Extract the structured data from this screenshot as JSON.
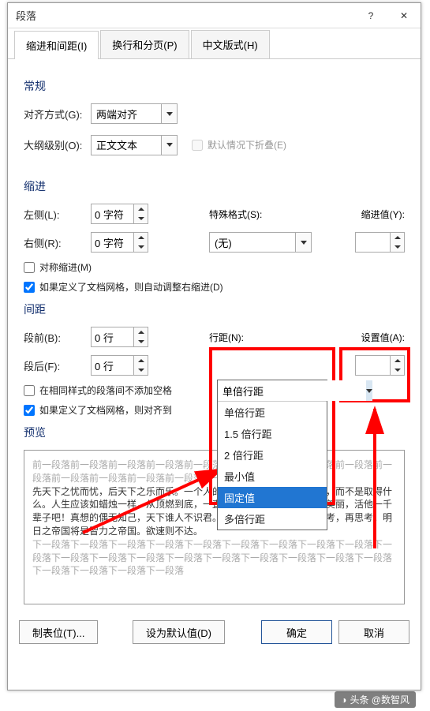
{
  "title": "段落",
  "tabs": [
    "缩进和间距(I)",
    "换行和分页(P)",
    "中文版式(H)"
  ],
  "general": {
    "header": "常规",
    "align_label": "对齐方式(G):",
    "align_value": "两端对齐",
    "outline_label": "大纲级别(O):",
    "outline_value": "正文文本",
    "collapse_label": "默认情况下折叠(E)"
  },
  "indent": {
    "header": "缩进",
    "left_label": "左侧(L):",
    "left_value": "0 字符",
    "right_label": "右侧(R):",
    "right_value": "0 字符",
    "special_label": "特殊格式(S):",
    "special_value": "(无)",
    "by_label": "缩进值(Y):",
    "by_value": "",
    "mirror_label": "对称缩进(M)",
    "autogrid_label": "如果定义了文档网格，则自动调整右缩进(D)"
  },
  "spacing": {
    "header": "间距",
    "before_label": "段前(B):",
    "before_value": "0 行",
    "after_label": "段后(F):",
    "after_value": "0 行",
    "linespacing_label": "行距(N):",
    "linespacing_value": "单倍行距",
    "at_label": "设置值(A):",
    "at_value": "",
    "options": [
      "单倍行距",
      "1.5 倍行距",
      "2 倍行距",
      "最小值",
      "固定值",
      "多倍行距"
    ],
    "nospace_label": "在相同样式的段落间不添加空格",
    "snapgrid_label": "如果定义了文档网格，则对齐到"
  },
  "preview": {
    "header": "预览",
    "gray1": "前一段落前一段落前一段落前一段落前一段落前一段落前一段落前一段落前一段落前一段落前一段落前一段落前一段落前一段落前一段落",
    "dark": "先天下之忧而忧，后天下之乐而乐。一个人的价值，应当看他贡献什么，而不是取得什么。人生应该如蜡烛一样，从顶燃到底，一直都是光明的。生活是这样美丽，活他一千辈子吧！真想的偶无知己，天下谁人不识君。学习知识要善于思考，思考，再思考。明日之帝国将是智力之帝国。欲速则不达。",
    "gray2": "下一段落下一段落下一段落下一段落下一段落下一段落下一段落下一段落下一段落下一段落下一段落下一段落下一段落下一段落下一段落下一段落下一段落下一段落下一段落下一段落下一段落下一段落下一段落"
  },
  "buttons": {
    "tabs": "制表位(T)...",
    "default": "设为默认值(D)",
    "ok": "确定",
    "cancel": "取消"
  },
  "watermark": "头条 @数智风"
}
